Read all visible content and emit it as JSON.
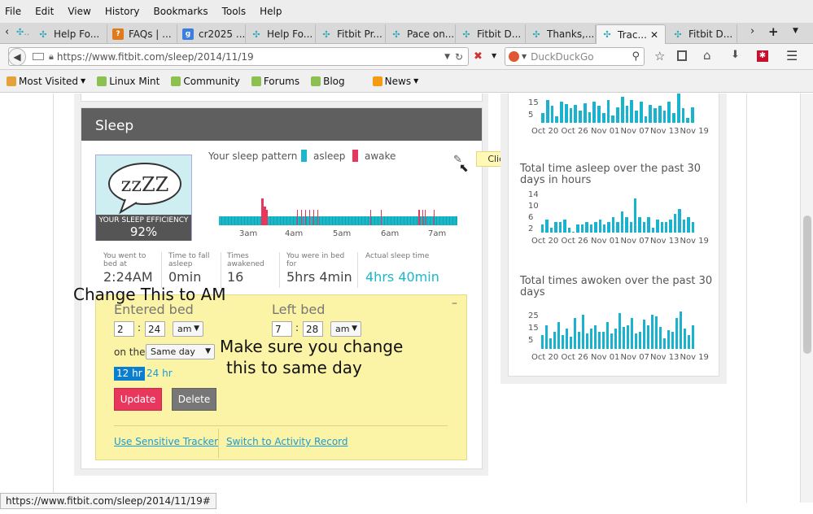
{
  "menu": [
    "File",
    "Edit",
    "View",
    "History",
    "Bookmarks",
    "Tools",
    "Help"
  ],
  "tabs": [
    {
      "label": "Help Fo...",
      "icon": "fitbit-icon"
    },
    {
      "label": "FAQs | ...",
      "icon": "faq-icon"
    },
    {
      "label": "cr2025 ...",
      "icon": "google-icon"
    },
    {
      "label": "Help Fo...",
      "icon": "fitbit-icon"
    },
    {
      "label": "Fitbit Pr...",
      "icon": "fitbit-icon"
    },
    {
      "label": "Pace on...",
      "icon": "fitbit-icon"
    },
    {
      "label": "Fitbit D...",
      "icon": "fitbit-icon"
    },
    {
      "label": "Thanks,...",
      "icon": "fitbit-icon"
    },
    {
      "label": "Trac...",
      "icon": "fitbit-icon"
    },
    {
      "label": "Fitbit D...",
      "icon": "fitbit-icon"
    }
  ],
  "url": "https://www.fitbit.com/sleep/2014/11/19",
  "search_placeholder": "DuckDuckGo",
  "bookmarks": [
    "Most Visited",
    "Linux Mint",
    "Community",
    "Forums",
    "Blog",
    "News"
  ],
  "sleep": {
    "title": "Sleep",
    "pattern_label": "Your sleep pattern",
    "asleep": "asleep",
    "awake": "awake",
    "click_to_edit": "Click to edit",
    "efficiency_label": "YOUR SLEEP EFFICIENCY",
    "efficiency_value": "92%",
    "zzz": "zzZZ",
    "times": [
      "3am",
      "4am",
      "5am",
      "6am",
      "7am"
    ],
    "stats": [
      {
        "label": "You went to bed at",
        "value": "2:24AM"
      },
      {
        "label": "Time to fall asleep",
        "value": "0min"
      },
      {
        "label": "Times awakened",
        "value": "16"
      },
      {
        "label": "You were in bed for",
        "value": "5hrs 4min"
      },
      {
        "label": "Actual sleep time",
        "value": "4hrs 40min"
      }
    ]
  },
  "editor": {
    "entered_bed": "Entered bed",
    "left_bed": "Left bed",
    "enter_hour": "2",
    "enter_min": "24",
    "enter_ampm": "am",
    "left_hour": "7",
    "left_min": "28",
    "left_ampm": "am",
    "on_the": "on the",
    "day": "Same day",
    "hr12": "12 hr",
    "hr24": "24 hr",
    "update": "Update",
    "delete": "Delete",
    "sensitive": "Use Sensitive Tracker",
    "switch": "Switch to Activity Record",
    "collapse": "–"
  },
  "annotations": {
    "am_note": "Change This to AM",
    "day_note_1": "Make sure you change",
    "day_note_2": "this to same day"
  },
  "charts": [
    {
      "title": "",
      "yticks": [
        "15",
        "5"
      ],
      "xticks": [
        "Oct 20",
        "Oct 26",
        "Nov 01",
        "Nov 07",
        "Nov 13",
        "Nov 19"
      ],
      "values": [
        9,
        22,
        16,
        6,
        20,
        18,
        14,
        17,
        12,
        19,
        10,
        20,
        16,
        9,
        22,
        7,
        15,
        25,
        16,
        22,
        12,
        20,
        6,
        17,
        14,
        16,
        12,
        20,
        9,
        28,
        14,
        5,
        15
      ]
    },
    {
      "title": "Total time asleep over the past 30 days in hours",
      "yticks": [
        "14",
        "10",
        "6",
        "2"
      ],
      "xticks": [
        "Oct 20",
        "Oct 26",
        "Nov 01",
        "Nov 07",
        "Nov 13",
        "Nov 19"
      ],
      "values": [
        3,
        5,
        2,
        4,
        4,
        5,
        2,
        0,
        3,
        3,
        4,
        3,
        4,
        5,
        3,
        4,
        6,
        4,
        8,
        6,
        4,
        13,
        6,
        4,
        6,
        2,
        5,
        4,
        4,
        5,
        7,
        9,
        5,
        6,
        4
      ]
    },
    {
      "title": "Total times awoken over the past 30 days",
      "yticks": [
        "25",
        "15",
        "5"
      ],
      "xticks": [
        "Oct 20",
        "Oct 26",
        "Nov 01",
        "Nov 07",
        "Nov 13",
        "Nov 19"
      ],
      "values": [
        8,
        14,
        6,
        10,
        16,
        8,
        12,
        7,
        18,
        10,
        20,
        9,
        12,
        14,
        10,
        10,
        16,
        9,
        12,
        21,
        13,
        14,
        18,
        9,
        10,
        17,
        14,
        20,
        19,
        13,
        6,
        11,
        10,
        18,
        22,
        12,
        8,
        14
      ]
    }
  ],
  "status_url": "https://www.fitbit.com/sleep/2014/11/19#"
}
